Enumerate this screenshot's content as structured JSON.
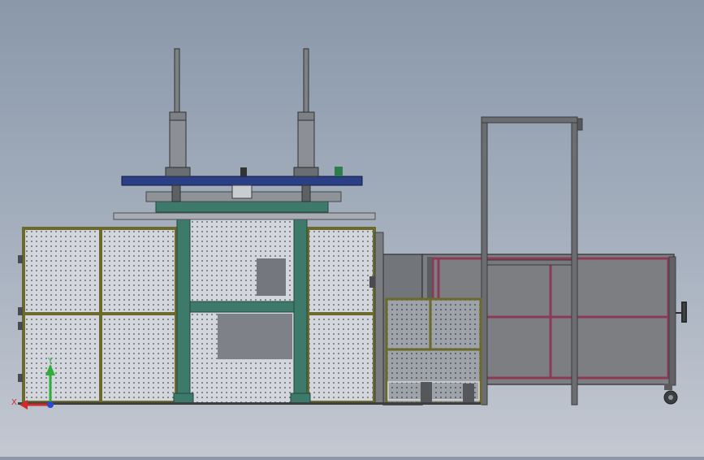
{
  "triad": {
    "x_label": "X",
    "y_label": "Y",
    "x_color": "#d22a2a",
    "y_color": "#2fae3a",
    "z_color": "#2a48d2"
  },
  "colors": {
    "mesh_frame": "#6b6a2a",
    "mesh_fill": "#c8ccd3",
    "green_frame": "#3d7a6a",
    "blue_platen": "#2b3f86",
    "gray_frame": "#6b6d70",
    "magenta_frame": "#8b3a55",
    "cart_fill": "#7c7e82"
  }
}
